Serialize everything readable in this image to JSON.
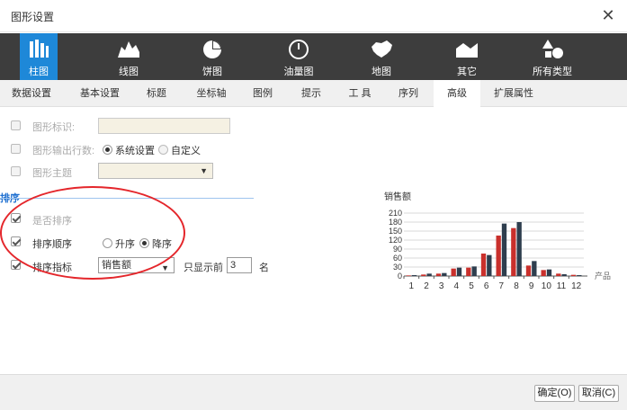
{
  "dialog": {
    "title": "图形设置",
    "close_glyph": "✕"
  },
  "chart_types": [
    {
      "id": "bar",
      "label": "柱图",
      "icon": "bar-chart-icon",
      "active": true
    },
    {
      "id": "line",
      "label": "线图",
      "icon": "line-chart-icon",
      "active": false
    },
    {
      "id": "pie",
      "label": "饼图",
      "icon": "pie-chart-icon",
      "active": false
    },
    {
      "id": "gauge",
      "label": "油量图",
      "icon": "gauge-icon",
      "active": false
    },
    {
      "id": "map",
      "label": "地图",
      "icon": "map-icon",
      "active": false
    },
    {
      "id": "other",
      "label": "其它",
      "icon": "area-shape-icon",
      "active": false
    },
    {
      "id": "all",
      "label": "所有类型",
      "icon": "shapes-icon",
      "active": false
    }
  ],
  "tabs": [
    {
      "label": "数据设置"
    },
    {
      "label": "基本设置"
    },
    {
      "label": "标题"
    },
    {
      "label": "坐标轴"
    },
    {
      "label": "图例"
    },
    {
      "label": "提示"
    },
    {
      "label": "工 具"
    },
    {
      "label": "序列"
    },
    {
      "label": "高级",
      "active": true
    },
    {
      "label": "扩展属性"
    }
  ],
  "form": {
    "graphic_id_label": "图形标识:",
    "output_rows_label": "图形输出行数:",
    "output_rows_options": [
      "系统设置",
      "自定义"
    ],
    "output_rows_selected": "系统设置",
    "theme_label": "图形主题",
    "theme_value": ""
  },
  "sort": {
    "section_title": "排序",
    "enable_label": "是否排序",
    "order_label": "排序顺序",
    "order_options": [
      "升序",
      "降序"
    ],
    "order_selected": "降序",
    "metric_label": "排序指标",
    "metric_value": "销售额",
    "show_top_label": "只显示前",
    "show_top_value": "3",
    "show_top_unit": "名"
  },
  "colors": {
    "accent": "#1e88d8",
    "series_red": "#c9302c",
    "series_dark": "#2e3e4e",
    "annotation": "#e4262b"
  },
  "chart_data": {
    "type": "bar",
    "title": "销售额",
    "xlabel": "产品",
    "categories": [
      "1",
      "2",
      "3",
      "4",
      "5",
      "6",
      "7",
      "8",
      "9",
      "10",
      "11",
      "12"
    ],
    "series": [
      {
        "color": "#c9302c",
        "values": [
          2,
          5,
          8,
          25,
          28,
          75,
          135,
          160,
          35,
          20,
          8,
          4
        ]
      },
      {
        "color": "#2e3e4e",
        "values": [
          3,
          8,
          10,
          28,
          32,
          70,
          175,
          180,
          50,
          22,
          6,
          3
        ]
      }
    ],
    "yticks": [
      0,
      30,
      60,
      90,
      120,
      150,
      180,
      210
    ],
    "ylim": [
      0,
      210
    ],
    "grid": true
  },
  "footer": {
    "ok_label": "确定(O)",
    "cancel_label": "取消(C)"
  }
}
